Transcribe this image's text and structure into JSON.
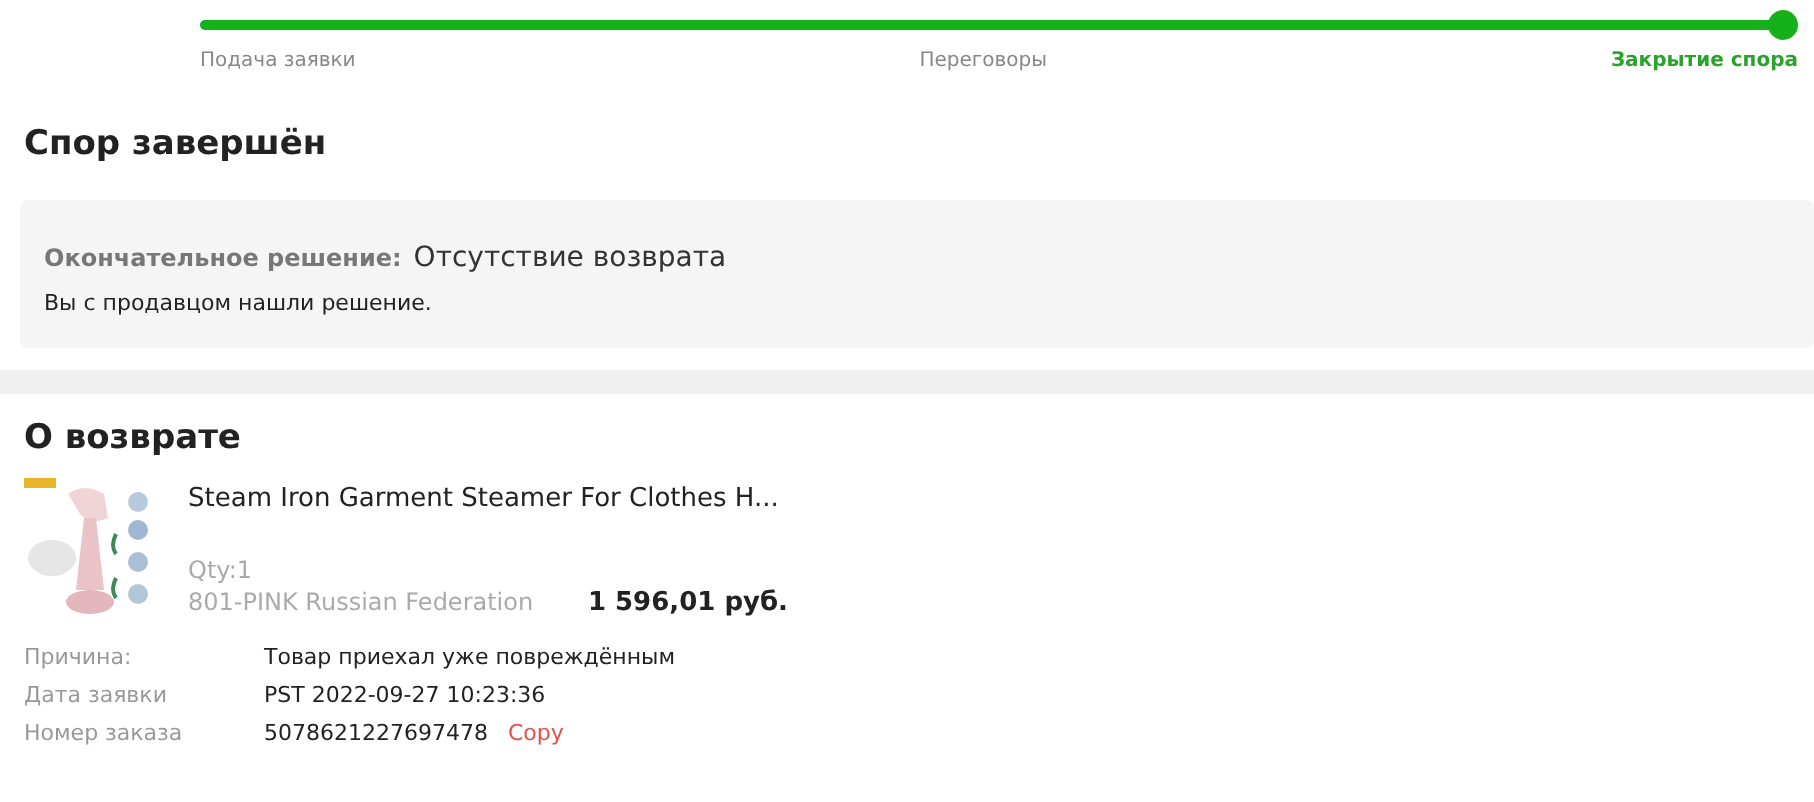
{
  "progress": {
    "level": 1,
    "stages": [
      {
        "label": "Подача заявки",
        "selected": false
      },
      {
        "label": "Переговоры",
        "selected": false
      },
      {
        "label": "Закрытие спора",
        "selected": true
      }
    ]
  },
  "status_title": "Спор завершён",
  "decision": {
    "label": "Окончательное решение:",
    "value": "Отсутствие возврата",
    "note": "Вы с продавцом нашли решение."
  },
  "return_section": {
    "title": "О возврате",
    "product": {
      "name": "Steam Iron Garment Steamer For Clothes H...",
      "qty": "Qty:1",
      "variant": "801-PINK Russian Federation",
      "price": "1 596,01 руб."
    },
    "details": [
      {
        "label": "Причина:",
        "value": "Товар приехал уже повреждённым"
      },
      {
        "label": "Дата заявки",
        "value": "PST 2022-09-27 10:23:36"
      },
      {
        "label": "Номер заказа",
        "value": "5078621227697478",
        "action": "Copy"
      }
    ]
  }
}
